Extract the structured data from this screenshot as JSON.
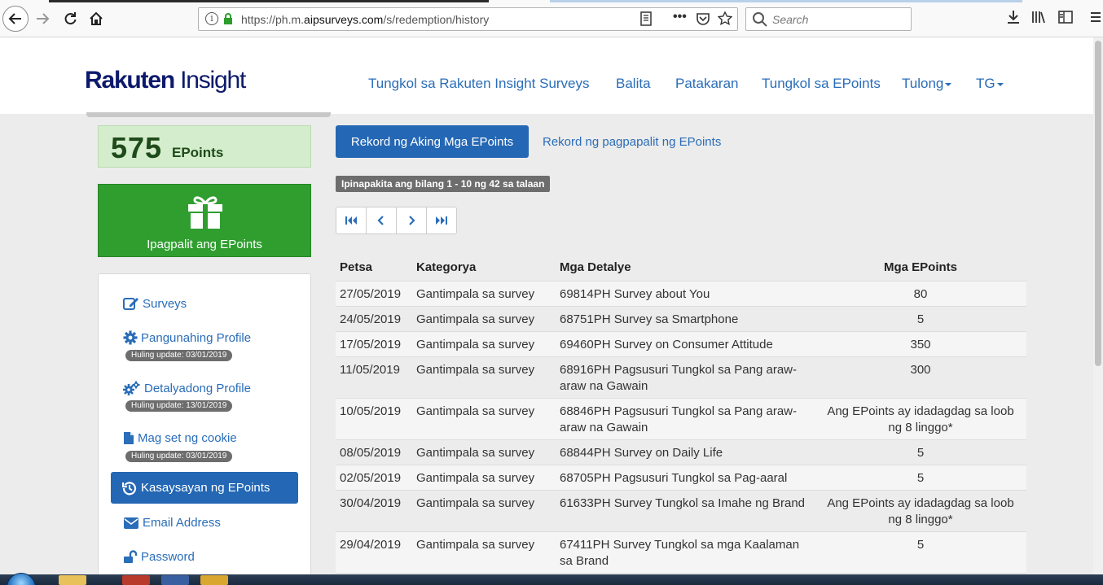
{
  "browser": {
    "url_prefix": "https://ph.m.",
    "url_domain": "aipsurveys.com",
    "url_path": "/s/redemption/history",
    "search_placeholder": "Search",
    "page_actions_icon": "•••"
  },
  "header": {
    "logo_bold": "Rakuten",
    "logo_light": " Insight",
    "nav": [
      {
        "label": "Tungkol sa Rakuten Insight Surveys"
      },
      {
        "label": "Balita"
      },
      {
        "label": "Patakaran"
      },
      {
        "label": "Tungkol sa EPoints"
      },
      {
        "label": "Tulong"
      },
      {
        "label": "TG"
      }
    ]
  },
  "sidebar": {
    "points_value": "575",
    "points_unit": "EPoints",
    "redeem_label": "Ipagpalit ang EPoints",
    "menu": {
      "surveys": "Surveys",
      "main_profile": "Pangunahing Profile",
      "main_profile_update": "Huling update: 03/01/2019",
      "detailed_profile": "Detalyadong Profile",
      "detailed_profile_update": "Huling update: 13/01/2019",
      "cookie": "Mag set ng cookie",
      "cookie_update": "Huling update: 03/01/2019",
      "history": "Kasaysayan ng EPoints",
      "email": "Email Address",
      "password": "Password"
    }
  },
  "main": {
    "tab_active": "Rekord ng Aking Mga EPoints",
    "tab_other": "Rekord ng pagpapalit ng EPoints",
    "count_text": "Ipinapakita ang bilang 1 - 10 ng 42 sa talaan",
    "table": {
      "headers": [
        "Petsa",
        "Kategorya",
        "Mga Detalye",
        "Mga EPoints"
      ],
      "rows": [
        {
          "date": "27/05/2019",
          "category": "Gantimpala sa survey",
          "details": "69814PH Survey about You",
          "points": "80"
        },
        {
          "date": "24/05/2019",
          "category": "Gantimpala sa survey",
          "details": "68751PH Survey sa Smartphone",
          "points": "5"
        },
        {
          "date": "17/05/2019",
          "category": "Gantimpala sa survey",
          "details": "69460PH Survey on Consumer Attitude",
          "points": "350"
        },
        {
          "date": "11/05/2019",
          "category": "Gantimpala sa survey",
          "details": "68916PH Pagsusuri Tungkol sa Pang araw-araw na Gawain",
          "points": "300"
        },
        {
          "date": "10/05/2019",
          "category": "Gantimpala sa survey",
          "details": "68846PH Pagsusuri Tungkol sa Pang araw-araw na Gawain",
          "points": "Ang EPoints ay idadagdag sa loob ng 8 linggo*"
        },
        {
          "date": "08/05/2019",
          "category": "Gantimpala sa survey",
          "details": "68844PH Survey on Daily Life",
          "points": "5"
        },
        {
          "date": "02/05/2019",
          "category": "Gantimpala sa survey",
          "details": "68705PH Pagsusuri Tungkol sa Pag-aaral",
          "points": "5"
        },
        {
          "date": "30/04/2019",
          "category": "Gantimpala sa survey",
          "details": "61633PH Survey Tungkol sa Imahe ng Brand",
          "points": "Ang EPoints ay idadagdag sa loob ng 8 linggo*"
        },
        {
          "date": "29/04/2019",
          "category": "Gantimpala sa survey",
          "details": "67411PH Survey Tungkol sa mga Kaalaman sa Brand",
          "points": "5"
        }
      ]
    }
  },
  "colors": {
    "link": "#2a6db8",
    "primary": "#2467b4",
    "redeem_green": "#2f9e2f",
    "points_bg": "#d4edcc"
  }
}
